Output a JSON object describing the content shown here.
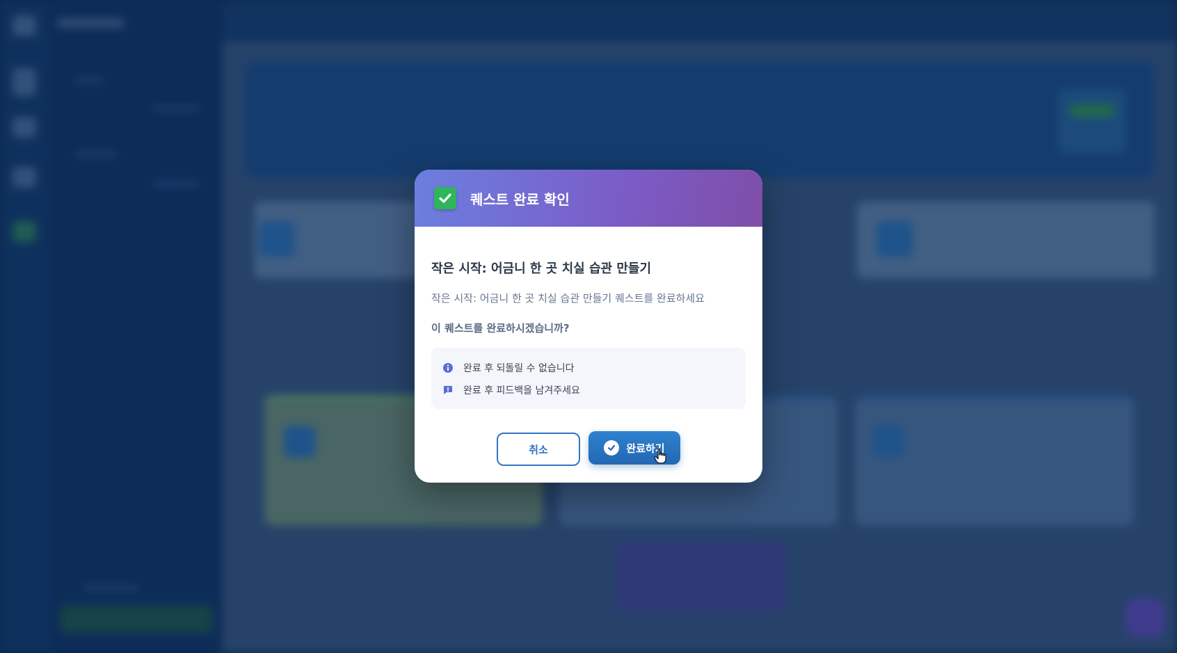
{
  "modal": {
    "title": "퀘스트 완료 확인",
    "quest_name": "작은 시작: 어금니 한 곳 치실 습관 만들기",
    "quest_description": "작은 시작: 어금니 한 곳 치실 습관 만들기 퀘스트를 완료하세요",
    "confirm_question": "이 퀘스트를 완료하시겠습니까?",
    "notices": [
      {
        "icon": "info-icon",
        "text": "완료 후 되돌릴 수 없습니다"
      },
      {
        "icon": "feedback-icon",
        "text": "완료 후 피드백을 남겨주세요"
      }
    ],
    "cancel_label": "취소",
    "complete_label": "완료하기"
  },
  "colors": {
    "header_gradient_start": "#6b7fe0",
    "header_gradient_end": "#7f4ea8",
    "check_green": "#2fb55a",
    "primary_blue": "#2f75c4",
    "overlay": "#0c264a"
  }
}
